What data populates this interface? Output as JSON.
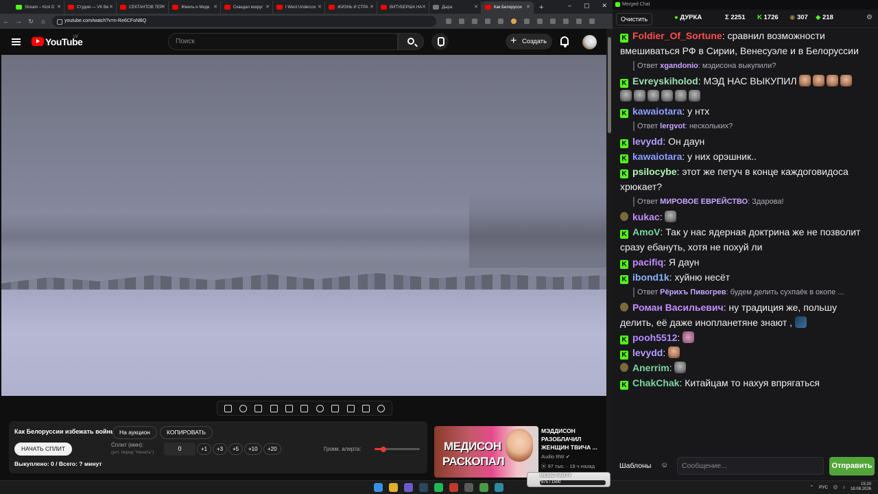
{
  "browser": {
    "tabs": [
      {
        "label": "Stream – Kick D",
        "icon": "kick-icon"
      },
      {
        "label": "Студия — VK Ви",
        "icon": "youtube-icon"
      },
      {
        "label": "СЕКТАНТОВ ТЕР",
        "icon": "youtube-icon"
      },
      {
        "label": "Жмиль и Медв",
        "icon": "youtube-icon"
      },
      {
        "label": "Скандал вокруг",
        "icon": "youtube-icon"
      },
      {
        "label": "I Went Undercov",
        "icon": "youtube-icon"
      },
      {
        "label": "ЖИЗНЬ И СТРА",
        "icon": "youtube-icon"
      },
      {
        "label": "ВИТУБЕРША НА",
        "icon": "youtube-icon"
      },
      {
        "label": "Дыра",
        "icon": "page-icon"
      },
      {
        "label": "Как Белорусси",
        "icon": "youtube-icon",
        "active": true
      }
    ],
    "url": "youtube.com/watch?v=n-Re6CFoNBQ"
  },
  "youtube": {
    "logo_text": "YouTube",
    "region": "LV",
    "search_placeholder": "Поиск",
    "create_label": "Создать"
  },
  "panel": {
    "title": "Как Белоруссии избежать войны",
    "auction_label": "На аукцион",
    "copy_label": "КОПИРОВАТЬ",
    "start_split_label": "НАЧАТЬ СПЛИТ",
    "split_label": "Сплит (мин):",
    "split_hint": "(уст. перед \"Начать\")",
    "split_value": "0",
    "increments": [
      "+1",
      "+3",
      "+5",
      "+10",
      "+20"
    ],
    "volume_label": "Громк. алерта:",
    "volume_level": 0.2,
    "status": "Выкуплено: 0 / Всего: ? минут"
  },
  "recommendation": {
    "thumb_line1": "МЕДИСОН",
    "thumb_line2": "РАСКОПАЛ",
    "title": "МЭДДИСОН РАЗОБЛАЧИЛ ЖЕНЩИН ТВИЧА ...",
    "channel": "Audio RW",
    "meta": "97 тыс. · 18 ч назад"
  },
  "chat": {
    "window_title": "Merged Chat",
    "clear_label": "Очистить",
    "stats": {
      "status": "ДУРКА",
      "sigma": "Σ 2251",
      "kick": "1726",
      "emote": "307",
      "green": "218"
    },
    "templates_label": "Шаблоны",
    "input_placeholder": "Сообщение...",
    "send_label": "Отправить",
    "colors": {
      "kick": "#53fc18",
      "send": "#53a53a"
    },
    "messages": [
      {
        "type": "msg",
        "badge": "kick",
        "user": "Foldier_Of_Sortune",
        "color": "#ff4d4d",
        "text": ": сравнил возможности вмешиваться РФ в Сирии, Венесуэле и в Белоруссии"
      },
      {
        "type": "reply",
        "prefix": "Ответ",
        "user": "xgandonio",
        "text": ": мэдисона выкупили?"
      },
      {
        "type": "msg",
        "badge": "kick",
        "user": "Evreyskiholod",
        "color": "#9de0b0",
        "text": ": МЭД НАС ВЫКУПИЛ",
        "emotes": 10
      },
      {
        "type": "msg",
        "badge": "kick",
        "user": "kawaiotara",
        "color": "#8aa0ff",
        "text": ": у нтх"
      },
      {
        "type": "reply",
        "prefix": "Ответ",
        "user": "lergvot",
        "text": ": нескольких?"
      },
      {
        "type": "msg",
        "badge": "kick",
        "user": "levydd",
        "color": "#b39dff",
        "text": ": Он даун"
      },
      {
        "type": "msg",
        "badge": "kick",
        "user": "kawaiotara",
        "color": "#8aa0ff",
        "text": ": у них орэшник.."
      },
      {
        "type": "msg",
        "badge": "kick",
        "user": "psilocybe",
        "color": "#b5f5b5",
        "text": ": этот же петуч в конце каждоговидоса хрюкает?"
      },
      {
        "type": "reply",
        "prefix": "Ответ",
        "user": "МИРОВОЕ ЕВРЕЙСТВО",
        "text": ": Здарова!"
      },
      {
        "type": "msg",
        "badge": "emote",
        "user": "kukac",
        "color": "#c58cff",
        "text": ":",
        "emotes": 1
      },
      {
        "type": "msg",
        "badge": "kick",
        "user": "AmoV",
        "color": "#7ad6a0",
        "text": ": Так у нас ядерная доктрина же не позволит сразу ебануть, хотя не похуй ли"
      },
      {
        "type": "msg",
        "badge": "kick",
        "user": "pacifiq",
        "color": "#c58cff",
        "text": ": Я даун"
      },
      {
        "type": "msg",
        "badge": "kick",
        "user": "ibond1k",
        "color": "#8ab4ff",
        "text": ": хуйню несёт"
      },
      {
        "type": "reply",
        "prefix": "Ответ",
        "user": "Рёрихъ Пивогрев",
        "text": ": будем делить сухпаёк в окопе ..."
      },
      {
        "type": "msg",
        "badge": "emote",
        "user": "Роман Васильевич",
        "color": "#c58cff",
        "text": ": ну традиция же, польшу делить, её даже инопланетяне знают ,",
        "emotes": 1
      },
      {
        "type": "msg",
        "badge": "kick",
        "user": "pooh5512",
        "color": "#b48cff",
        "text": ":",
        "emotes": 1
      },
      {
        "type": "msg",
        "badge": "kick",
        "user": "levydd",
        "color": "#b39dff",
        "text": ":",
        "emotes": 1
      },
      {
        "type": "msg",
        "badge": "emote",
        "user": "Anerrim",
        "color": "#7ad6a0",
        "text": ":",
        "emotes": 1
      },
      {
        "type": "msg",
        "badge": "kick",
        "user": "ChakChak",
        "color": "#7ad6a0",
        "text": ": Китайцам то нахуя впрягаться"
      }
    ]
  },
  "taskbar": {
    "widget_title": "MEME PARTY",
    "widget_progress": "875 / 1500",
    "lang": "РУС",
    "time": "15:20",
    "date": "18.08.2026"
  }
}
